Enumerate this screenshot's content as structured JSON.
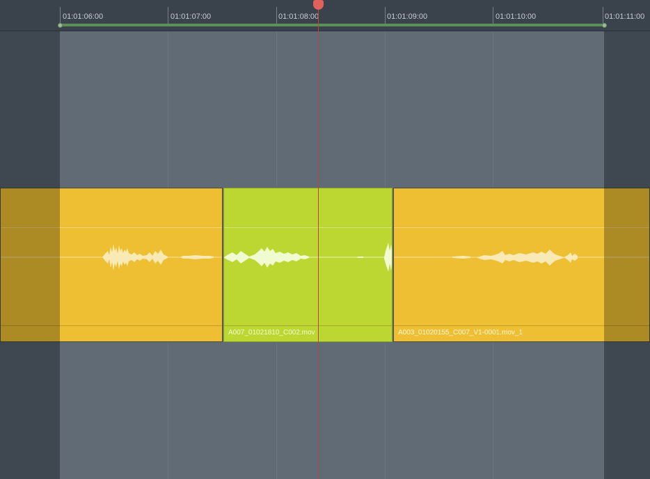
{
  "timeline": {
    "ruler": {
      "timecodes": [
        "01:01:06:00",
        "01:01:07:00",
        "01:01:08:00",
        "01:01:09:00",
        "01:01:10:00",
        "01:01:11:00"
      ]
    },
    "clips": [
      {
        "name": "",
        "color": "#efbf33",
        "kind": "audio"
      },
      {
        "name": "A007_01021810_C002.mov",
        "color": "#bcd632",
        "kind": "audio"
      },
      {
        "name": "A003_01020155_C007_V1-0001.mov_1",
        "color": "#efbf33",
        "kind": "audio"
      }
    ],
    "playhead": {
      "timecode": "01:01:08:00"
    },
    "colors": {
      "background": "#3d4550",
      "in_out_range": "#616b76",
      "range_bar": "#5c8f5a",
      "playhead": "#e0625a"
    }
  }
}
